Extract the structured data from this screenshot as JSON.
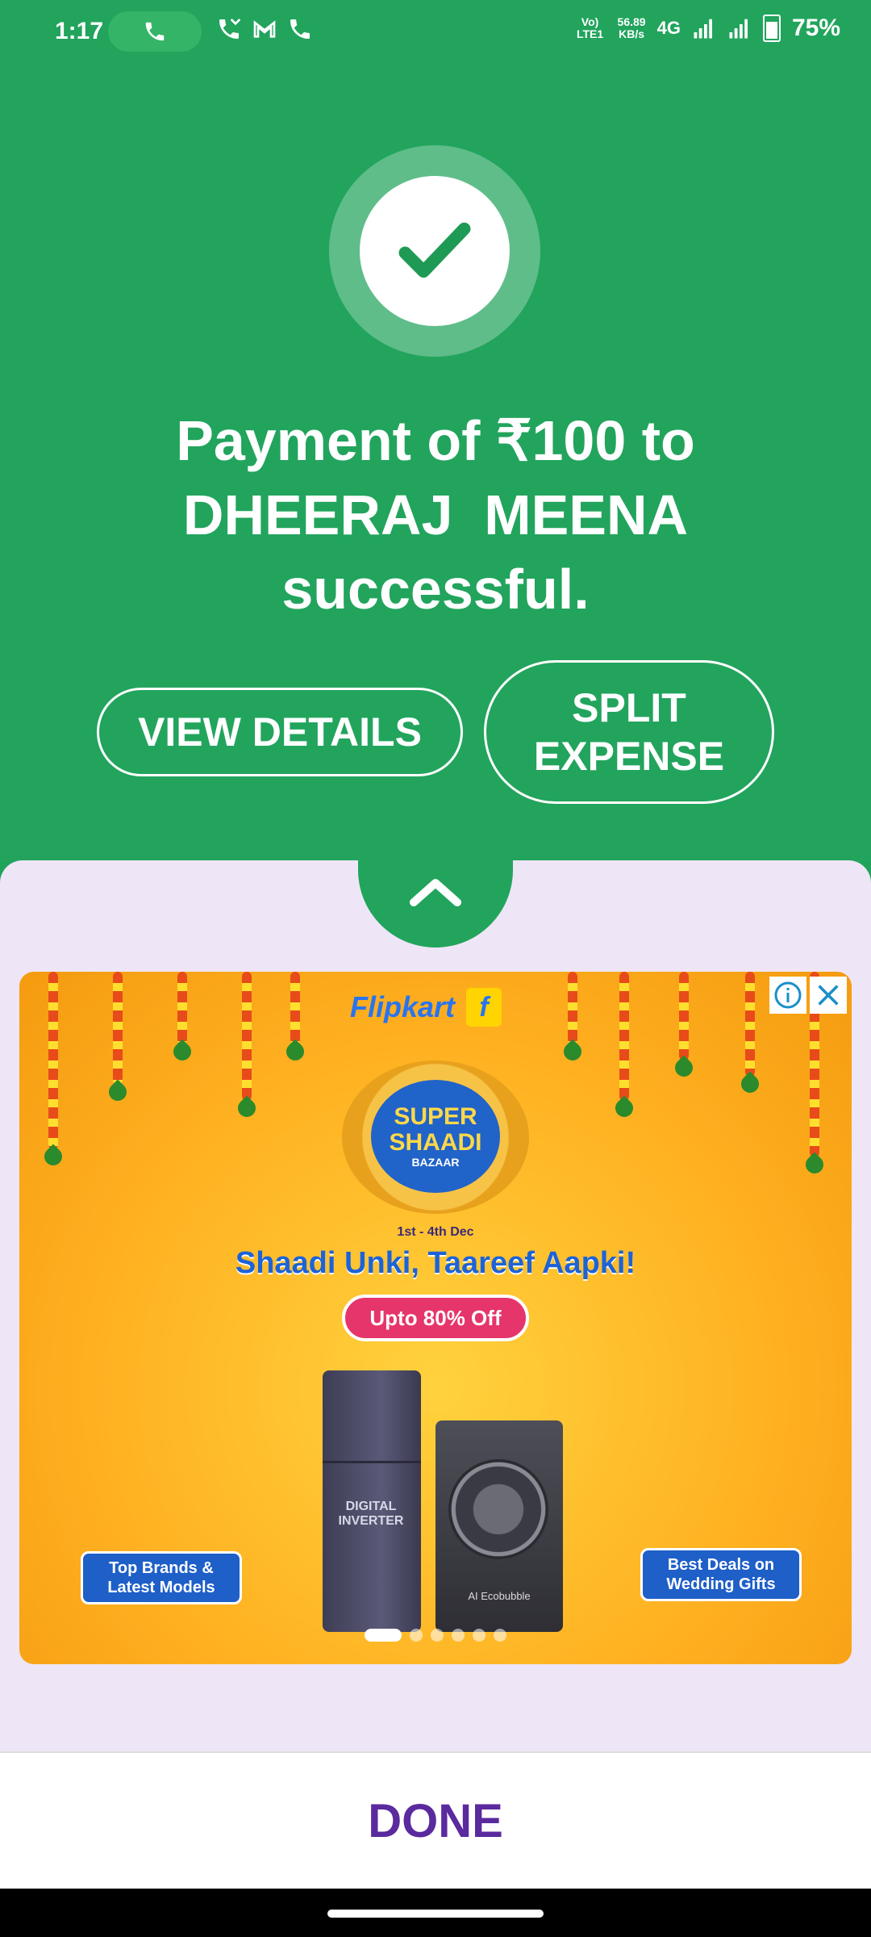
{
  "status_bar": {
    "time": "1:17",
    "network_label": "Vo) LTE1",
    "speed_value": "56.89",
    "speed_unit": "KB/s",
    "network_type": "4G",
    "battery": "75%"
  },
  "confirmation": {
    "headline_line1": "Payment of ₹100 to",
    "headline_line2": "DHEERAJ  MEENA",
    "headline_line3": "successful.",
    "view_details_label": "VIEW DETAILS",
    "split_label_line1": "SPLIT",
    "split_label_line2": "EXPENSE",
    "accent_color": "#22a45d"
  },
  "ad": {
    "brand": "Flipkart",
    "brand_mark": "f",
    "event_line1": "SUPER",
    "event_line2": "SHAADI",
    "event_line3": "BAZAAR",
    "dates": "1st - 4th Dec",
    "tagline": "Shaadi Unki, Taareef Aapki!",
    "offer": "Upto 80% Off",
    "fridge_text": "DIGITAL INVERTER",
    "washer_text": "AI Ecobubble",
    "promo_left": "Top Brands & Latest Models",
    "promo_right": "Best Deals on Wedding Gifts",
    "info_icon": "info-icon",
    "close_icon": "close-icon",
    "carousel_total": 6,
    "carousel_active": 1
  },
  "footer": {
    "done_label": "DONE",
    "done_color": "#5a2a9e"
  }
}
